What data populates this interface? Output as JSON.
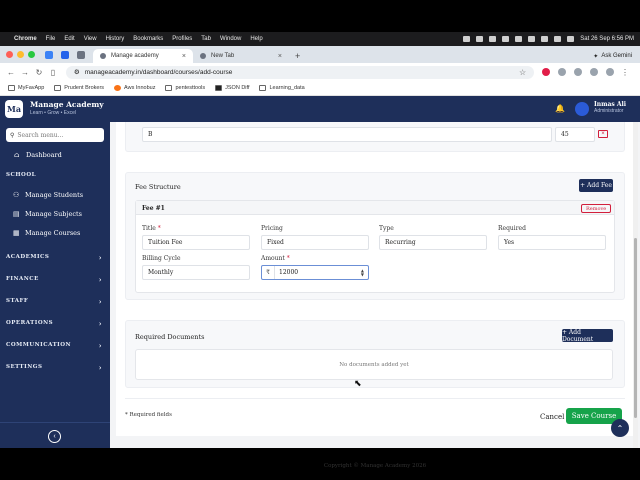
{
  "menubar": {
    "app": "Chrome",
    "items": [
      "File",
      "Edit",
      "View",
      "History",
      "Bookmarks",
      "Profiles",
      "Tab",
      "Window",
      "Help"
    ],
    "datetime": "Sat 26 Sep  6:56 PM"
  },
  "tabs": [
    {
      "title": "Manage academy",
      "active": true
    },
    {
      "title": "New Tab",
      "active": false
    }
  ],
  "browser": {
    "url": "manageacademy.in/dashboard/courses/add-course",
    "ask_gemini": "Ask Gemini"
  },
  "bookmarks": [
    "MyFavApp",
    "Prudent Brokers",
    "Aws Innobuz",
    "pentesttools",
    "JSON Diff",
    "Learning_data"
  ],
  "app": {
    "brand_name": "Manage Academy",
    "brand_tagline": "Learn • Grow • Excel",
    "user_name": "Inmas Ali",
    "user_role": "Administrator"
  },
  "sidebar": {
    "search_placeholder": "Search menu...",
    "dashboard": "Dashboard",
    "school_section": "SCHOOL",
    "school_items": [
      "Manage Students",
      "Manage Subjects",
      "Manage Courses"
    ],
    "sections": [
      "ACADEMICS",
      "FINANCE",
      "STAFF",
      "OPERATIONS",
      "COMMUNICATION",
      "SETTINGS"
    ]
  },
  "subject_row": {
    "name": "B",
    "value": "45",
    "remove_glyph": "×"
  },
  "fee_structure": {
    "title": "Fee Structure",
    "add_button": "+ Add Fee",
    "fee_title": "Fee #1",
    "remove_button": "Remove",
    "labels": {
      "title": "Title",
      "pricing": "Pricing",
      "type": "Type",
      "required": "Required",
      "billing_cycle": "Billing Cycle",
      "amount": "Amount",
      "required_mark": "*"
    },
    "values": {
      "title": "Tuition Fee",
      "pricing": "Fixed",
      "type": "Recurring",
      "required": "Yes",
      "billing_cycle": "Monthly",
      "currency": "₹",
      "amount": "12000"
    }
  },
  "documents": {
    "title": "Required Documents",
    "add_button": "+ Add Document",
    "empty_text": "No documents added yet"
  },
  "form_footer": {
    "required_note": "* Required fields",
    "cancel": "Cancel",
    "save": "Save Course"
  },
  "copyright": "Copyright © Manage Academy 2026"
}
